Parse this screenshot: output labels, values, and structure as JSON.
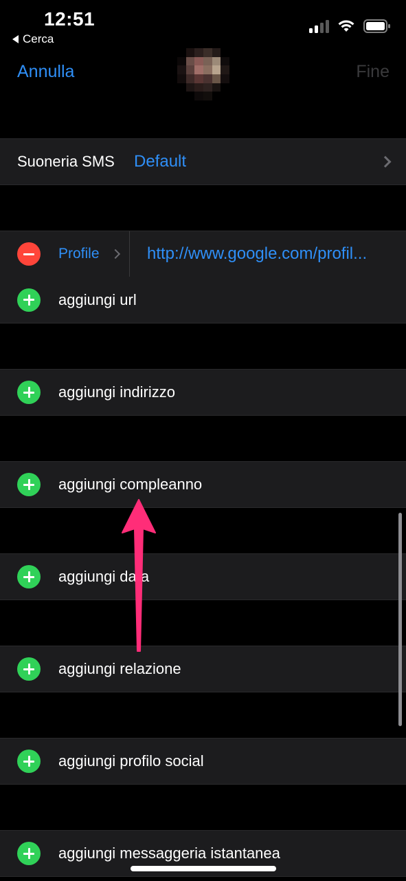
{
  "status_bar": {
    "time": "12:51",
    "back_label": "Cerca",
    "signal_icon": "cellular-signal-icon",
    "wifi_icon": "wifi-icon",
    "battery_icon": "battery-icon"
  },
  "nav": {
    "cancel_label": "Annulla",
    "done_label": "Fine"
  },
  "sms_ringtone": {
    "label": "Suoneria SMS",
    "value": "Default"
  },
  "url_section": {
    "entry": {
      "label": "Profile",
      "value": "http://www.google.com/profil..."
    },
    "add_label": "aggiungi url"
  },
  "add_rows": [
    "aggiungi indirizzo",
    "aggiungi compleanno",
    "aggiungi data",
    "aggiungi relazione",
    "aggiungi profilo social",
    "aggiungi messaggeria istantanea"
  ],
  "colors": {
    "accent_blue": "#2f8ff7",
    "add_green": "#30d158",
    "remove_red": "#ff453a",
    "annotation_arrow": "#ff2d78"
  }
}
